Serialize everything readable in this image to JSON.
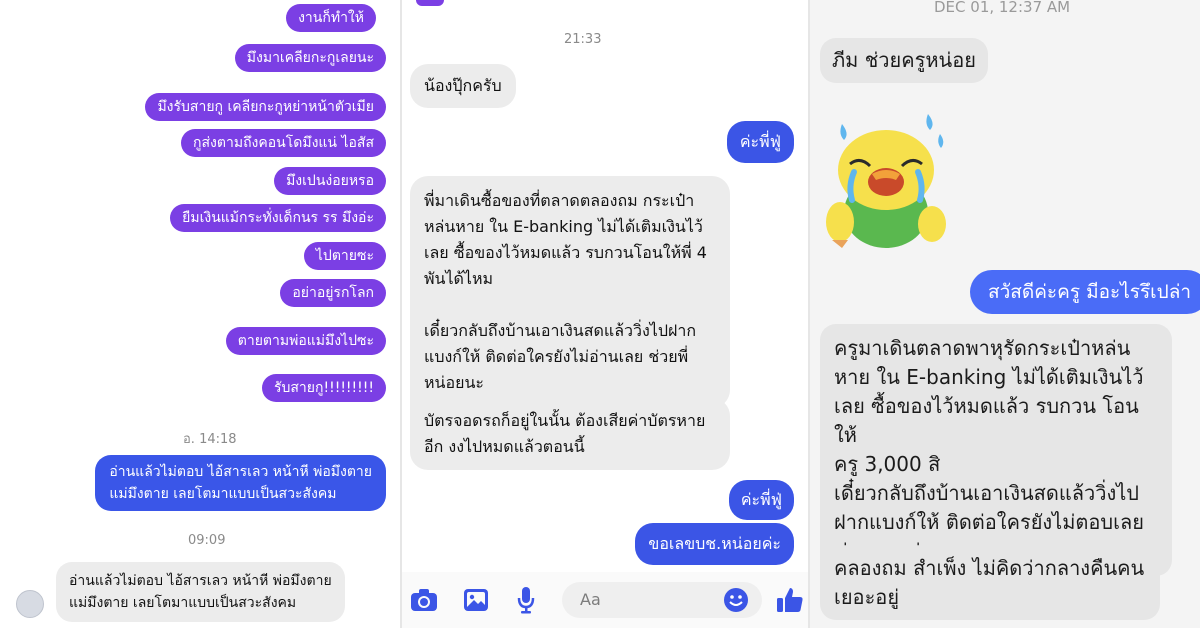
{
  "panel1": {
    "outgoing": [
      "งานก็ทำให้",
      "มึงมาเคลียกะกูเลยนะ",
      "มึงรับสายกู เคลียกะกูหย่าหน้าตัวเมีย",
      "กูส่งตามถึงคอนโดมึงแน่ ไอสัส",
      "มึงเปนง่อยหรอ",
      "ยืมเงินแม้กระทั่งเด็กนร รร มึงอ่ะ",
      "ไปตายซะ",
      "อย่าอยู่รกโลก",
      "ตายตามพ่อแม่มึงไปซะ",
      "รับสายกู!!!!!!!!!"
    ],
    "time_1": "อ. 14:18",
    "blue_message": "อ่านแล้วไม่ตอบ ไอ้สารเลว หน้าหี พ่อมึงตาย\nแม่มึงตาย เลยโตมาแบบเป็นสวะสังคม",
    "time_2": "09:09",
    "grey_message": "อ่านแล้วไม่ตอบ ไอ้สารเลว หน้าหี พ่อมึงตาย\nแม่มึงตาย เลยโตมาแบบเป็นสวะสังคม"
  },
  "panel2": {
    "time": "21:33",
    "msg_1": "น้องปุ๊กครับ",
    "reply_1": "ค่ะพี่ฟู่",
    "msg_2": "พี่มาเดินซื้อของที่ตลาดตลองถม กระเป๋า\nหล่นหาย  ใน E-banking ไม่ได้เติมเงินไว้\nเลย ซื้อของไว้หมดแล้ว รบกวนโอนให้พี่ 4\nพันได้ไหม\n\nเดี๋ยวกลับถึงบ้านเอาเงินสดแล้ววิ่งไปฝาก\nแบงก์ให้ ติดต่อใครยังไม่อ่านเลย ช่วยพี่\nหน่อยนะ",
    "msg_3": "บัตรจอดรถก็อยู่ในนั้น ต้องเสียค่าบัตรหาย\nอีก งงไปหมดแล้วตอนนี้",
    "reply_2": "ค่ะพี่ฟู่",
    "reply_3": "ขอเลขบช.หน่อยค่ะ",
    "composer_placeholder": "Aa",
    "icons": [
      "camera-icon",
      "image-icon",
      "microphone-icon",
      "emoji-icon",
      "thumbs-up-icon"
    ],
    "accent": "#3b55e6"
  },
  "panel3": {
    "header_time": "DEC 01, 12:37 AM",
    "msg_1": "ภีม ช่วยครูหน่อย",
    "reply_1": "สวัสดีค่ะครู มีอะไรรึเปล่า",
    "msg_2": "ครูมาเดินตลาดพาหุรัดกระเป๋าหล่น\nหาย  ใน E-banking ไม่ได้เติมเงินไว้\nเลย ซื้อของไว้หมดแล้ว รบกวน โอนให้\nครู 3,000 สิ\nเดี๋ยวกลับถึงบ้านเอาเงินสดแล้ววิ่งไป\nฝากแบงก์ให้ ติดต่อใครยังไม่ตอบเลย\nช่วยครูหน่อย",
    "msg_3": "คลองถม สำเพ็ง ไม่คิดว่ากลางคืนคน\nเยอะอยู่",
    "sticker": "crying-bird-sticker"
  },
  "colors": {
    "purple": "#7b3fe4",
    "blue": "#3a56e8",
    "grey_bubble": "#ececec"
  }
}
